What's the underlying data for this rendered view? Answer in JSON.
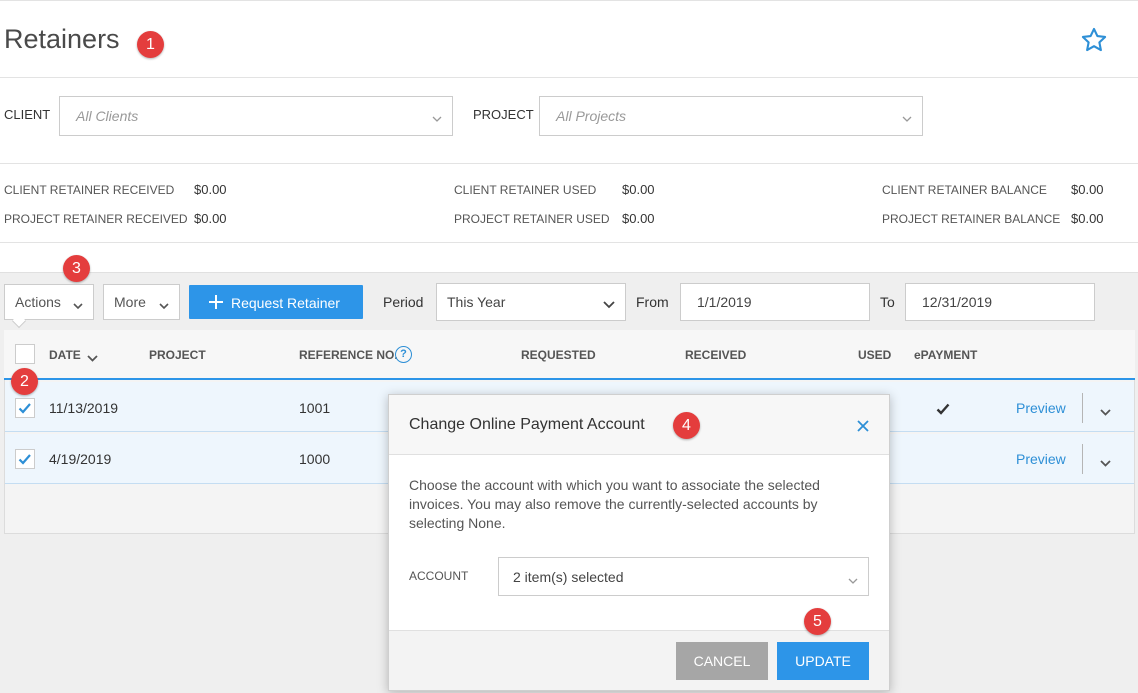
{
  "header": {
    "title": "Retainers",
    "badge": "1"
  },
  "filters": {
    "client_label": "CLIENT",
    "client_placeholder": "All Clients",
    "project_label": "PROJECT",
    "project_placeholder": "All Projects"
  },
  "summary": {
    "client_received_label": "CLIENT RETAINER RECEIVED",
    "client_received_value": "$0.00",
    "project_received_label": "PROJECT RETAINER RECEIVED",
    "project_received_value": "$0.00",
    "client_used_label": "CLIENT RETAINER USED",
    "client_used_value": "$0.00",
    "project_used_label": "PROJECT RETAINER USED",
    "project_used_value": "$0.00",
    "client_balance_label": "CLIENT RETAINER BALANCE",
    "client_balance_value": "$0.00",
    "project_balance_label": "PROJECT RETAINER BALANCE",
    "project_balance_value": "$0.00"
  },
  "toolbar": {
    "badge": "3",
    "actions_label": "Actions",
    "more_label": "More",
    "request_label": "Request Retainer",
    "period_label": "Period",
    "period_value": "This Year",
    "from_label": "From",
    "from_value": "1/1/2019",
    "to_label": "To",
    "to_value": "12/31/2019"
  },
  "table": {
    "columns": [
      "DATE",
      "PROJECT",
      "REFERENCE NO.",
      "REQUESTED",
      "RECEIVED",
      "USED",
      "ePAYMENT"
    ],
    "badge": "2",
    "rows": [
      {
        "date": "11/13/2019",
        "reference": "1001",
        "action": "Preview"
      },
      {
        "date": "4/19/2019",
        "reference": "1000",
        "action": "Preview"
      }
    ]
  },
  "modal": {
    "title": "Change Online Payment Account",
    "badge_title": "4",
    "description": "Choose the account with which you want to associate the selected invoices. You may also remove the currently-selected accounts by selecting None.",
    "account_label": "ACCOUNT",
    "account_value": "2 item(s) selected",
    "badge_update": "5",
    "cancel_label": "CANCEL",
    "update_label": "UPDATE"
  },
  "colors": {
    "accent": "#2d95e8",
    "badge": "#e43d3d",
    "cancel": "#a6a6a6"
  }
}
